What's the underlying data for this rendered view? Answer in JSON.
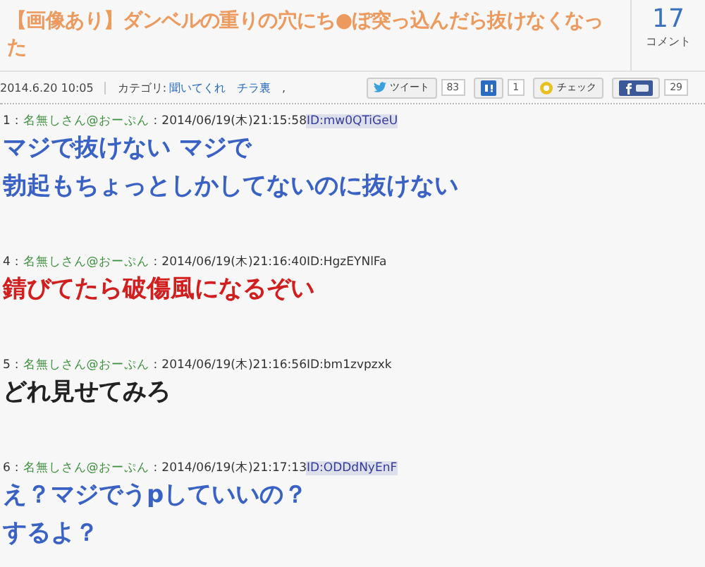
{
  "article": {
    "title": "【画像あり】ダンベルの重りの穴にち●ぽ突っ込んだら抜けなくなった",
    "comment_count": "17",
    "comment_label": "コメント"
  },
  "meta": {
    "date": "2014.6.20 10:05",
    "category_label": "カテゴリ:",
    "categories": [
      "聞いてくれ",
      "チラ裏"
    ],
    "separator": ","
  },
  "share": [
    {
      "kind": "twitter",
      "label": "ツイート",
      "count": "83"
    },
    {
      "kind": "hatena",
      "count": "1"
    },
    {
      "kind": "livedoor",
      "label": "チェック"
    },
    {
      "kind": "facebook",
      "count": "29"
    }
  ],
  "posts": [
    {
      "number": "1",
      "separator": ":",
      "name": "名無しさん@おーぷん",
      "date": "2014/06/19(木)21:15:58",
      "id": "ID:mw0QTiGeU",
      "id_highlighted": true,
      "color": "#3a62c4",
      "lines": [
        "マジで抜けない マジで",
        "勃起もちょっとしかしてないのに抜けない"
      ]
    },
    {
      "number": "4",
      "separator": ":",
      "name": "名無しさん@おーぷん",
      "date": "2014/06/19(木)21:16:40",
      "id": "ID:HgzEYNlFa",
      "id_highlighted": false,
      "color": "#d11f1f",
      "lines": [
        "錆びてたら破傷風になるぞい"
      ]
    },
    {
      "number": "5",
      "separator": ":",
      "name": "名無しさん@おーぷん",
      "date": "2014/06/19(木)21:16:56",
      "id": "ID:bm1zvpzxk",
      "id_highlighted": false,
      "color": "#222222",
      "lines": [
        "どれ見せてみろ"
      ]
    },
    {
      "number": "6",
      "separator": ":",
      "name": "名無しさん@おーぷん",
      "date": "2014/06/19(木)21:17:13",
      "id": "ID:ODDdNyEnF",
      "id_highlighted": true,
      "color": "#3a62c4",
      "lines": [
        "え？マジでうpしていいの？",
        "するよ？"
      ]
    }
  ]
}
